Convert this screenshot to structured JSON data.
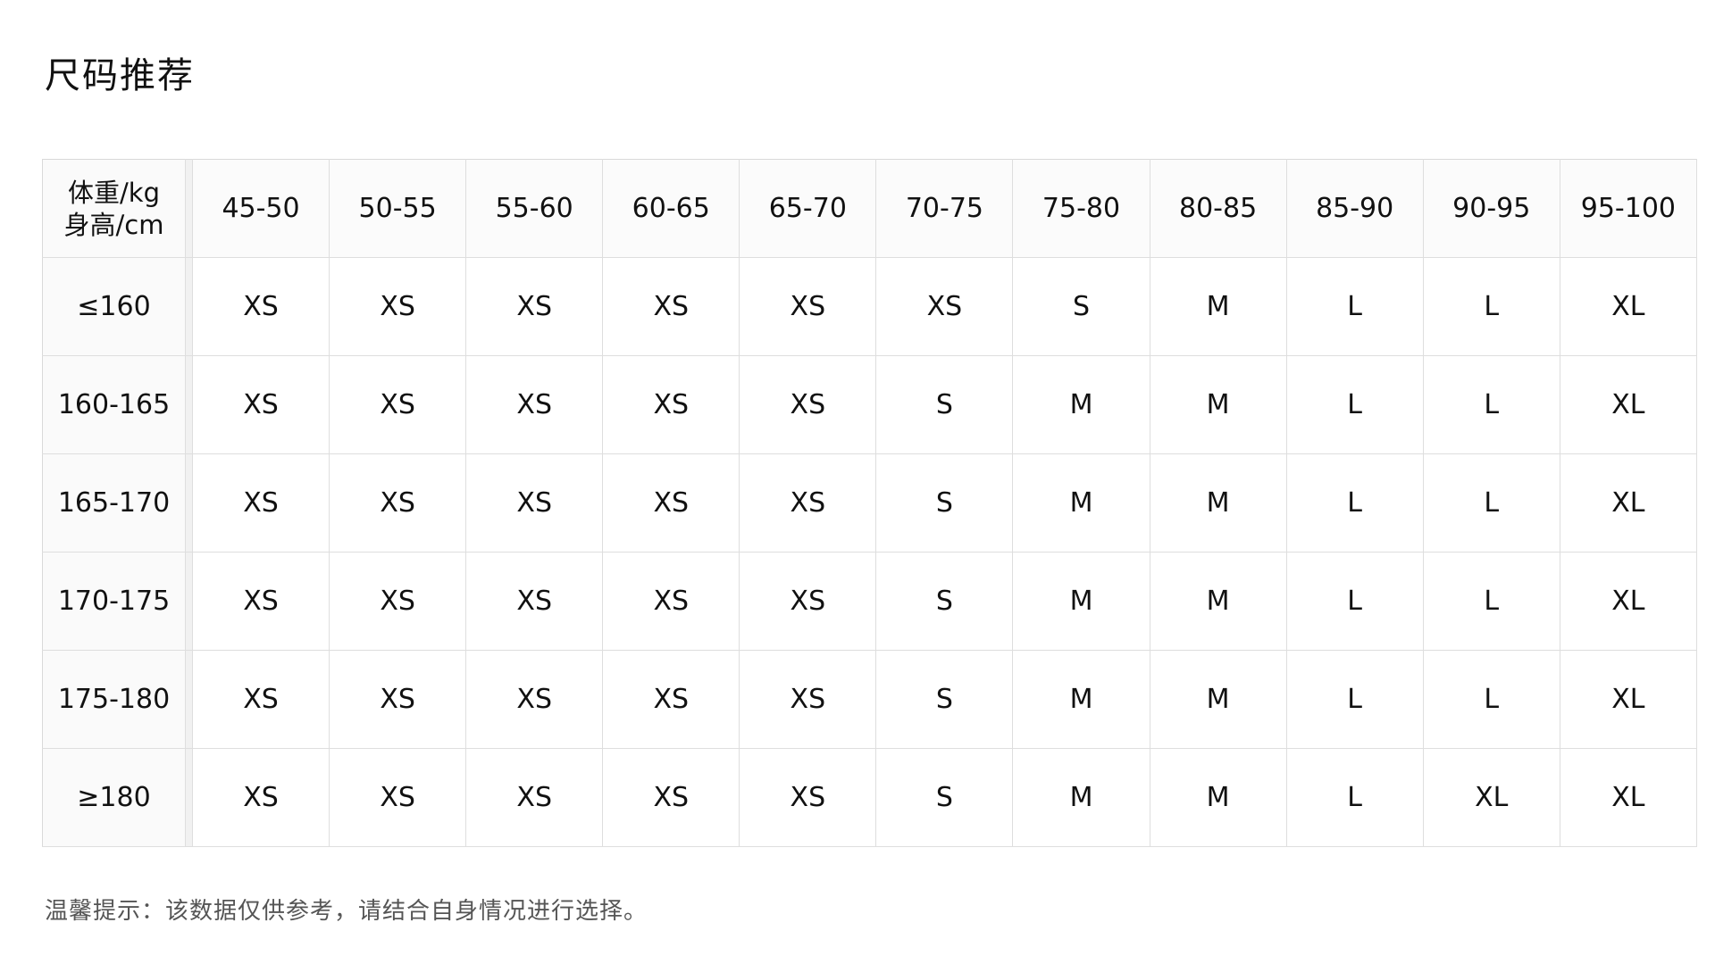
{
  "page": {
    "title": "尺码推荐",
    "footnote": "温馨提示：该数据仅供参考，请结合自身情况进行选择。"
  },
  "table": {
    "corner_line1": "体重/kg",
    "corner_line2": "身高/cm",
    "weight_ranges": [
      "45-50",
      "50-55",
      "55-60",
      "60-65",
      "65-70",
      "70-75",
      "75-80",
      "80-85",
      "85-90",
      "90-95",
      "95-100"
    ],
    "rows": [
      {
        "height": "≤160",
        "sizes": [
          "XS",
          "XS",
          "XS",
          "XS",
          "XS",
          "XS",
          "S",
          "M",
          "L",
          "L",
          "XL"
        ]
      },
      {
        "height": "160-165",
        "sizes": [
          "XS",
          "XS",
          "XS",
          "XS",
          "XS",
          "S",
          "M",
          "M",
          "L",
          "L",
          "XL"
        ]
      },
      {
        "height": "165-170",
        "sizes": [
          "XS",
          "XS",
          "XS",
          "XS",
          "XS",
          "S",
          "M",
          "M",
          "L",
          "L",
          "XL"
        ]
      },
      {
        "height": "170-175",
        "sizes": [
          "XS",
          "XS",
          "XS",
          "XS",
          "XS",
          "S",
          "M",
          "M",
          "L",
          "L",
          "XL"
        ]
      },
      {
        "height": "175-180",
        "sizes": [
          "XS",
          "XS",
          "XS",
          "XS",
          "XS",
          "S",
          "M",
          "M",
          "L",
          "L",
          "XL"
        ]
      },
      {
        "height": "≥180",
        "sizes": [
          "XS",
          "XS",
          "XS",
          "XS",
          "XS",
          "S",
          "M",
          "M",
          "L",
          "XL",
          "XL"
        ]
      }
    ]
  }
}
